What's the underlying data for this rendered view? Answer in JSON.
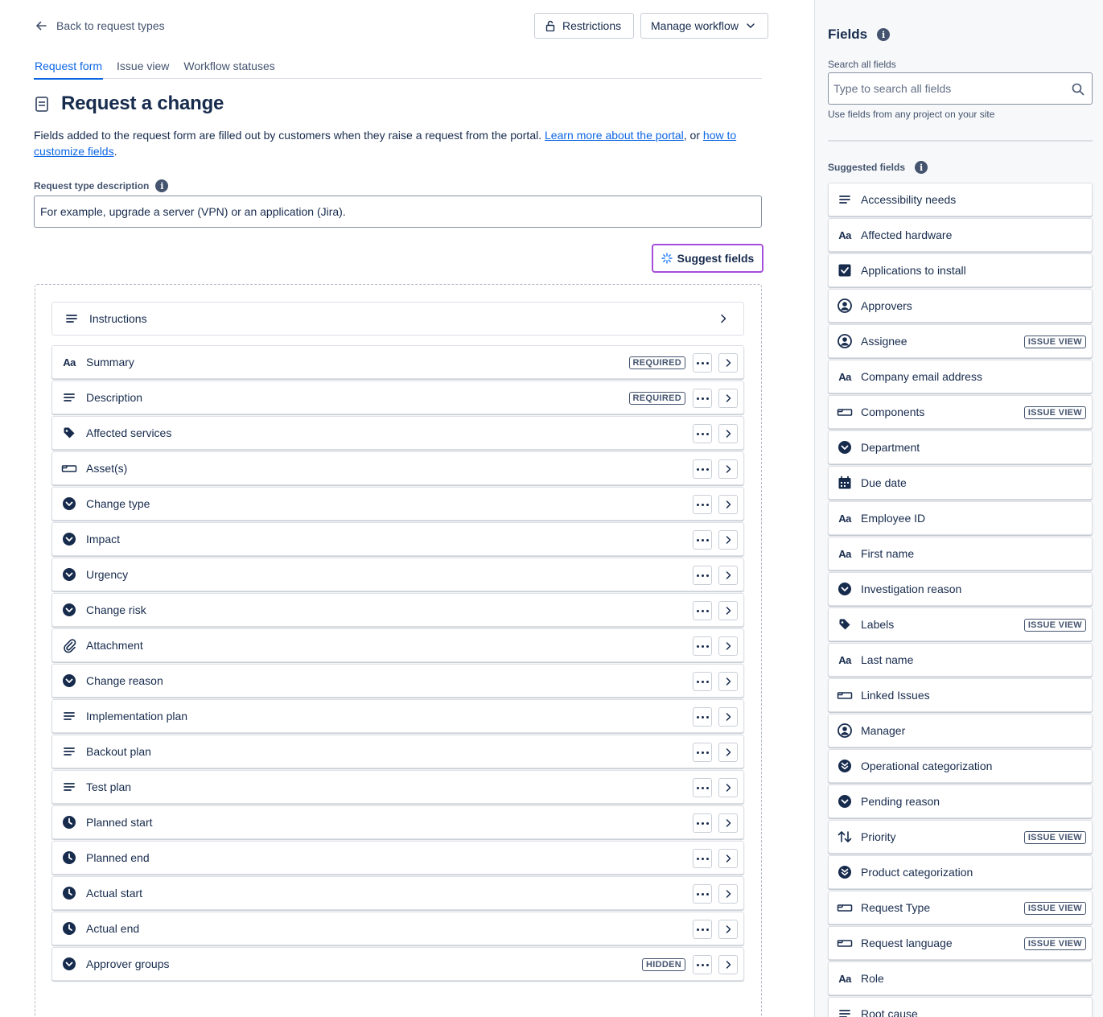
{
  "header": {
    "back_label": "Back to request types",
    "restrictions_label": "Restrictions",
    "manage_workflow_label": "Manage workflow"
  },
  "tabs": [
    {
      "label": "Request form",
      "active": true
    },
    {
      "label": "Issue view",
      "active": false
    },
    {
      "label": "Workflow statuses",
      "active": false
    }
  ],
  "page": {
    "title": "Request a change",
    "intro_text": "Fields added to the request form are filled out by customers when they raise a request from the portal. ",
    "intro_link1": "Learn more about the portal",
    "intro_mid": ", or ",
    "intro_link2": "how to customize fields",
    "intro_end": ".",
    "description_label": "Request type description",
    "description_value": "For example, upgrade a server (VPN) or an application (Jira).",
    "suggest_fields_label": "Suggest fields"
  },
  "instructions_label": "Instructions",
  "form_fields": [
    {
      "label": "Summary",
      "icon": "text-icon",
      "badge": "REQUIRED"
    },
    {
      "label": "Description",
      "icon": "paragraph-icon",
      "badge": "REQUIRED"
    },
    {
      "label": "Affected services",
      "icon": "tag-icon",
      "badge": ""
    },
    {
      "label": "Asset(s)",
      "icon": "object-icon",
      "badge": ""
    },
    {
      "label": "Change type",
      "icon": "select-icon",
      "badge": ""
    },
    {
      "label": "Impact",
      "icon": "select-icon",
      "badge": ""
    },
    {
      "label": "Urgency",
      "icon": "select-icon",
      "badge": ""
    },
    {
      "label": "Change risk",
      "icon": "select-icon",
      "badge": ""
    },
    {
      "label": "Attachment",
      "icon": "attachment-icon",
      "badge": ""
    },
    {
      "label": "Change reason",
      "icon": "select-icon",
      "badge": ""
    },
    {
      "label": "Implementation plan",
      "icon": "paragraph-icon",
      "badge": ""
    },
    {
      "label": "Backout plan",
      "icon": "paragraph-icon",
      "badge": ""
    },
    {
      "label": "Test plan",
      "icon": "paragraph-icon",
      "badge": ""
    },
    {
      "label": "Planned start",
      "icon": "clock-icon",
      "badge": ""
    },
    {
      "label": "Planned end",
      "icon": "clock-icon",
      "badge": ""
    },
    {
      "label": "Actual start",
      "icon": "clock-icon",
      "badge": ""
    },
    {
      "label": "Actual end",
      "icon": "clock-icon",
      "badge": ""
    },
    {
      "label": "Approver groups",
      "icon": "select-icon",
      "badge": "HIDDEN"
    }
  ],
  "panel": {
    "title": "Fields",
    "search_label": "Search all fields",
    "search_placeholder": "Type to search all fields",
    "search_help": "Use fields from any project on your site",
    "suggested_label": "Suggested fields"
  },
  "suggested_fields": [
    {
      "label": "Accessibility needs",
      "icon": "paragraph-icon",
      "badge": ""
    },
    {
      "label": "Affected hardware",
      "icon": "text-icon",
      "badge": ""
    },
    {
      "label": "Applications to install",
      "icon": "checkbox-icon",
      "badge": ""
    },
    {
      "label": "Approvers",
      "icon": "user-icon",
      "badge": ""
    },
    {
      "label": "Assignee",
      "icon": "user-icon",
      "badge": "ISSUE VIEW"
    },
    {
      "label": "Company email address",
      "icon": "text-icon",
      "badge": ""
    },
    {
      "label": "Components",
      "icon": "object-icon",
      "badge": "ISSUE VIEW"
    },
    {
      "label": "Department",
      "icon": "select-icon",
      "badge": ""
    },
    {
      "label": "Due date",
      "icon": "calendar-icon",
      "badge": ""
    },
    {
      "label": "Employee ID",
      "icon": "text-icon",
      "badge": ""
    },
    {
      "label": "First name",
      "icon": "text-icon",
      "badge": ""
    },
    {
      "label": "Investigation reason",
      "icon": "select-icon",
      "badge": ""
    },
    {
      "label": "Labels",
      "icon": "tag-icon",
      "badge": "ISSUE VIEW"
    },
    {
      "label": "Last name",
      "icon": "text-icon",
      "badge": ""
    },
    {
      "label": "Linked Issues",
      "icon": "object-icon",
      "badge": ""
    },
    {
      "label": "Manager",
      "icon": "user-icon",
      "badge": ""
    },
    {
      "label": "Operational categorization",
      "icon": "cascade-icon",
      "badge": ""
    },
    {
      "label": "Pending reason",
      "icon": "select-icon",
      "badge": ""
    },
    {
      "label": "Priority",
      "icon": "priority-icon",
      "badge": "ISSUE VIEW"
    },
    {
      "label": "Product categorization",
      "icon": "cascade-icon",
      "badge": ""
    },
    {
      "label": "Request Type",
      "icon": "object-icon",
      "badge": "ISSUE VIEW"
    },
    {
      "label": "Request language",
      "icon": "object-icon",
      "badge": "ISSUE VIEW"
    },
    {
      "label": "Role",
      "icon": "text-icon",
      "badge": ""
    },
    {
      "label": "Root cause",
      "icon": "paragraph-icon",
      "badge": ""
    }
  ]
}
